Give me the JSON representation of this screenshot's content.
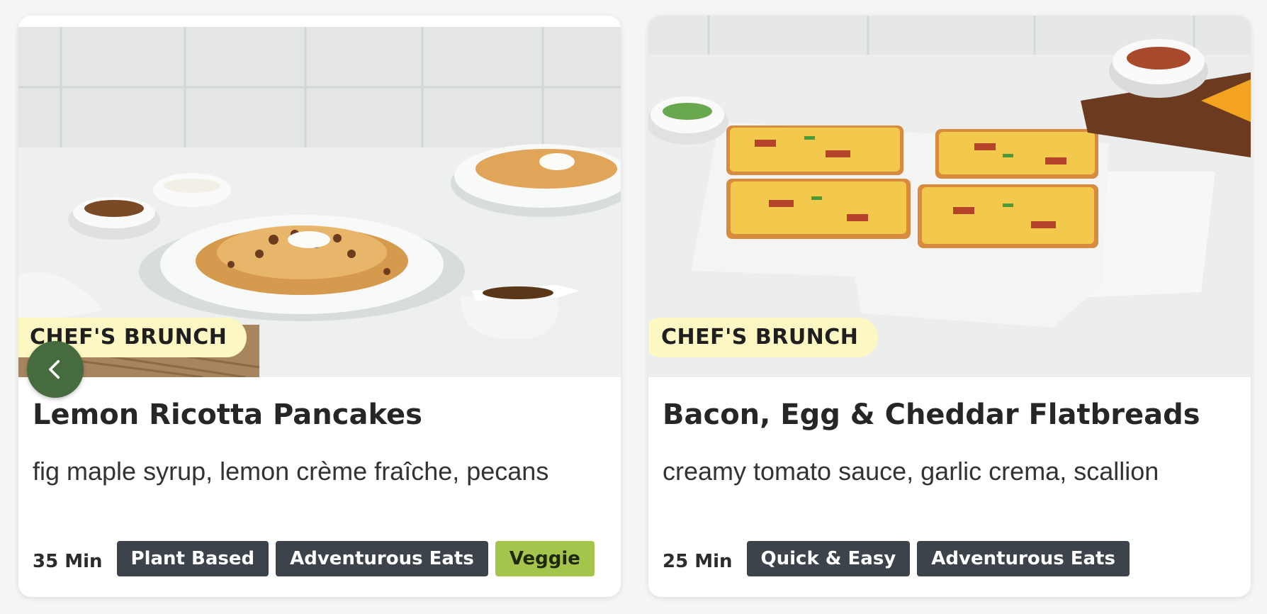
{
  "cards": [
    {
      "badge": "CHEF'S BRUNCH",
      "title": "Lemon Ricotta Pancakes",
      "subtitle": "fig maple syrup, lemon crème fraîche, pecans",
      "time": "35 Min",
      "tags": [
        "Plant Based",
        "Adventurous Eats",
        "Veggie"
      ]
    },
    {
      "badge": "CHEF'S BRUNCH",
      "title": "Bacon, Egg & Cheddar Flatbreads",
      "subtitle": "creamy tomato sauce, garlic crema, scallion",
      "time": "25 Min",
      "tags": [
        "Quick & Easy",
        "Adventurous Eats"
      ]
    }
  ],
  "carousel": {
    "prev_icon": "chevron-left-icon"
  },
  "colors": {
    "badge_bg": "#fdf7c3",
    "tag_bg": "#3c434b",
    "veggie_tag_bg": "#a4c44c",
    "nav_button_bg": "#456b3f"
  }
}
